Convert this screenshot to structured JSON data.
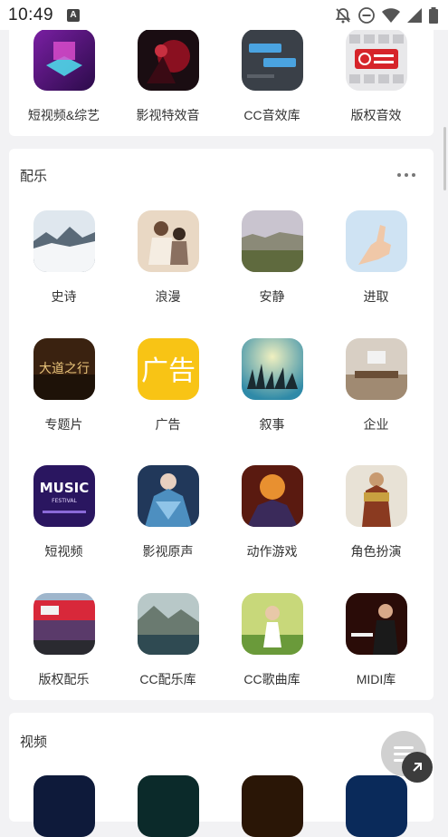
{
  "status_bar": {
    "time": "10:49",
    "notification_letter": "A",
    "icons": [
      "notifications-off-icon",
      "do-not-disturb-icon",
      "wifi-icon",
      "signal-icon",
      "battery-icon"
    ]
  },
  "sound_effects": {
    "items": [
      {
        "label": "短视频&综艺",
        "icon": "short-video-variety-thumb"
      },
      {
        "label": "影视特效音",
        "icon": "film-sfx-thumb"
      },
      {
        "label": "CC音效库",
        "icon": "cc-sfx-library-thumb"
      },
      {
        "label": "版权音效",
        "icon": "copyright-sfx-thumb"
      }
    ]
  },
  "music": {
    "title": "配乐",
    "more_icon": "more-dots-icon",
    "items": [
      {
        "label": "史诗",
        "icon": "epic-thumb"
      },
      {
        "label": "浪漫",
        "icon": "romantic-thumb"
      },
      {
        "label": "安静",
        "icon": "quiet-thumb"
      },
      {
        "label": "进取",
        "icon": "aggressive-thumb"
      },
      {
        "label": "专题片",
        "icon": "documentary-thumb",
        "overlay": "大道之行"
      },
      {
        "label": "广告",
        "icon": "advertising-thumb",
        "overlay": "广告"
      },
      {
        "label": "叙事",
        "icon": "narrative-thumb"
      },
      {
        "label": "企业",
        "icon": "corporate-thumb"
      },
      {
        "label": "短视频",
        "icon": "short-video-thumb",
        "overlay": "MUSIC",
        "overlay_sub": "FESTIVAL"
      },
      {
        "label": "影视原声",
        "icon": "film-soundtrack-thumb"
      },
      {
        "label": "动作游戏",
        "icon": "action-game-thumb"
      },
      {
        "label": "角色扮演",
        "icon": "role-play-thumb"
      },
      {
        "label": "版权配乐",
        "icon": "copyright-music-thumb"
      },
      {
        "label": "CC配乐库",
        "icon": "cc-music-library-thumb"
      },
      {
        "label": "CC歌曲库",
        "icon": "cc-song-library-thumb"
      },
      {
        "label": "MIDI库",
        "icon": "midi-library-thumb"
      }
    ]
  },
  "video": {
    "title": "视频"
  },
  "fab": {
    "icon": "menu-lines-icon"
  }
}
